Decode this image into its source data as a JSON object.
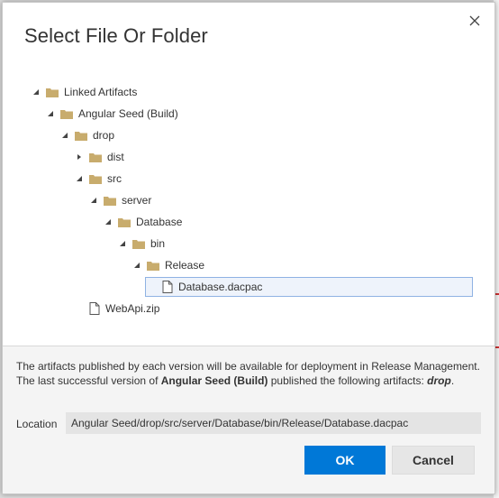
{
  "dialog": {
    "title": "Select File Or Folder",
    "close_icon": "close-icon"
  },
  "tree": [
    {
      "label": "Linked Artifacts",
      "type": "folder",
      "expanded": true,
      "level": 0
    },
    {
      "label": "Angular Seed (Build)",
      "type": "folder",
      "expanded": true,
      "level": 1
    },
    {
      "label": "drop",
      "type": "folder",
      "expanded": true,
      "level": 2
    },
    {
      "label": "dist",
      "type": "folder",
      "expanded": false,
      "level": 3
    },
    {
      "label": "src",
      "type": "folder",
      "expanded": true,
      "level": 3
    },
    {
      "label": "server",
      "type": "folder",
      "expanded": true,
      "level": 4
    },
    {
      "label": "Database",
      "type": "folder",
      "expanded": true,
      "level": 5
    },
    {
      "label": "bin",
      "type": "folder",
      "expanded": true,
      "level": 6
    },
    {
      "label": "Release",
      "type": "folder",
      "expanded": true,
      "level": 7
    },
    {
      "label": "Database.dacpac",
      "type": "file",
      "selected": true,
      "level": 8
    },
    {
      "label": "WebApi.zip",
      "type": "file",
      "level": 3
    }
  ],
  "footer": {
    "info_line1": "The artifacts published by each version will be available for deployment in Release Management.",
    "info_line2_prefix": "The last successful version of ",
    "info_line2_build": "Angular Seed (Build)",
    "info_line2_middle": " published the following artifacts: ",
    "info_line2_artifact": "drop",
    "info_line2_suffix": ".",
    "location_label": "Location",
    "location_value": "Angular Seed/drop/src/server/Database/bin/Release/Database.dacpac",
    "ok_label": "OK",
    "cancel_label": "Cancel"
  },
  "colors": {
    "accent": "#0078d7",
    "folder": "#c8ab6d",
    "selection_border": "#8fb2e3"
  }
}
